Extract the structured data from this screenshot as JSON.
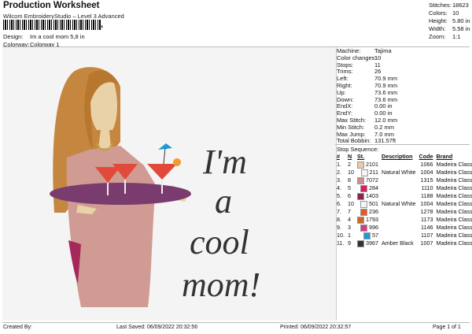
{
  "header": {
    "title": "Production Worksheet",
    "subtitle": "Wilcom EmbroideryStudio – Level 3 Advanced",
    "design_label": "Design:",
    "design_value": "Im a cool mom 5,8 in",
    "colorway_label": "Colorway:",
    "colorway_value": "Colorway 1"
  },
  "summary": {
    "stitches_label": "Stitches:",
    "stitches": "18623",
    "colors_label": "Colors:",
    "colors": "10",
    "height_label": "Height:",
    "height": "5.80 in",
    "width_label": "Width:",
    "width": "5.58 in",
    "zoom_label": "Zoom:",
    "zoom": "1:1"
  },
  "machine_info": [
    {
      "label": "Machine:",
      "value": "Tajima"
    },
    {
      "label": "Color changes:",
      "value": "10"
    },
    {
      "label": "Stops:",
      "value": "11"
    },
    {
      "label": "Trims:",
      "value": "26"
    },
    {
      "label": "Left:",
      "value": "70.9 mm"
    },
    {
      "label": "Right:",
      "value": "70.9 mm"
    },
    {
      "label": "Up:",
      "value": "73.6 mm"
    },
    {
      "label": "Down:",
      "value": "73.6 mm"
    },
    {
      "label": "EndX:",
      "value": "0.00 in"
    },
    {
      "label": "EndY:",
      "value": "0.00 in"
    },
    {
      "label": "Max Stitch:",
      "value": "12.0 mm"
    },
    {
      "label": "Min Stitch:",
      "value": "0.2 mm"
    },
    {
      "label": "Max Jump:",
      "value": "7.0 mm"
    },
    {
      "label": "Total Bobbin:",
      "value": "131.57ft"
    }
  ],
  "stop_sequence": {
    "title": "Stop Sequence:",
    "headers": [
      "#",
      "N",
      "St.",
      "Description",
      "Code",
      "Brand"
    ],
    "rows": [
      {
        "num": "1.",
        "n": "2",
        "color": "#e9c9a8",
        "st": "2101",
        "desc": "",
        "code": "1066",
        "brand": "Madeira Classic 40"
      },
      {
        "num": "2.",
        "n": "10",
        "color": "#f4f4f4",
        "st": "211",
        "desc": "Natural White",
        "code": "1004",
        "brand": "Madeira Classic 40"
      },
      {
        "num": "3.",
        "n": "8",
        "color": "#c9908a",
        "st": "7072",
        "desc": "",
        "code": "1315",
        "brand": "Madeira Classic 40"
      },
      {
        "num": "4.",
        "n": "5",
        "color": "#d81e5b",
        "st": "284",
        "desc": "",
        "code": "1110",
        "brand": "Madeira Classic 40"
      },
      {
        "num": "5.",
        "n": "6",
        "color": "#8a2350",
        "st": "1403",
        "desc": "",
        "code": "1188",
        "brand": "Madeira Classic 40"
      },
      {
        "num": "6.",
        "n": "10",
        "color": "#f4f4f4",
        "st": "501",
        "desc": "Natural White",
        "code": "1004",
        "brand": "Madeira Classic 40"
      },
      {
        "num": "7.",
        "n": "7",
        "color": "#e65a2a",
        "st": "236",
        "desc": "",
        "code": "1278",
        "brand": "Madeira Classic 40"
      },
      {
        "num": "8.",
        "n": "4",
        "color": "#c66a2a",
        "st": "1793",
        "desc": "",
        "code": "1173",
        "brand": "Madeira Classic 40"
      },
      {
        "num": "9.",
        "n": "3",
        "color": "#d83a8a",
        "st": "996",
        "desc": "",
        "code": "1146",
        "brand": "Madeira Classic 40"
      },
      {
        "num": "10.",
        "n": "1",
        "color": "#1a9ad6",
        "st": "57",
        "desc": "",
        "code": "1107",
        "brand": "Madeira Classic 40"
      },
      {
        "num": "11.",
        "n": "9",
        "color": "#333333",
        "st": "3967",
        "desc": "Amber Black",
        "code": "1007",
        "brand": "Madeira Classic 40"
      }
    ]
  },
  "design_text": [
    "I'm",
    "a",
    "cool",
    "mom!"
  ],
  "footer": {
    "created_by": "Created By:",
    "last_saved": "Last Saved: 06/09/2022 20:32:56",
    "printed": "Printed: 06/09/2022 20:32:57",
    "page": "Page 1 of 1"
  }
}
